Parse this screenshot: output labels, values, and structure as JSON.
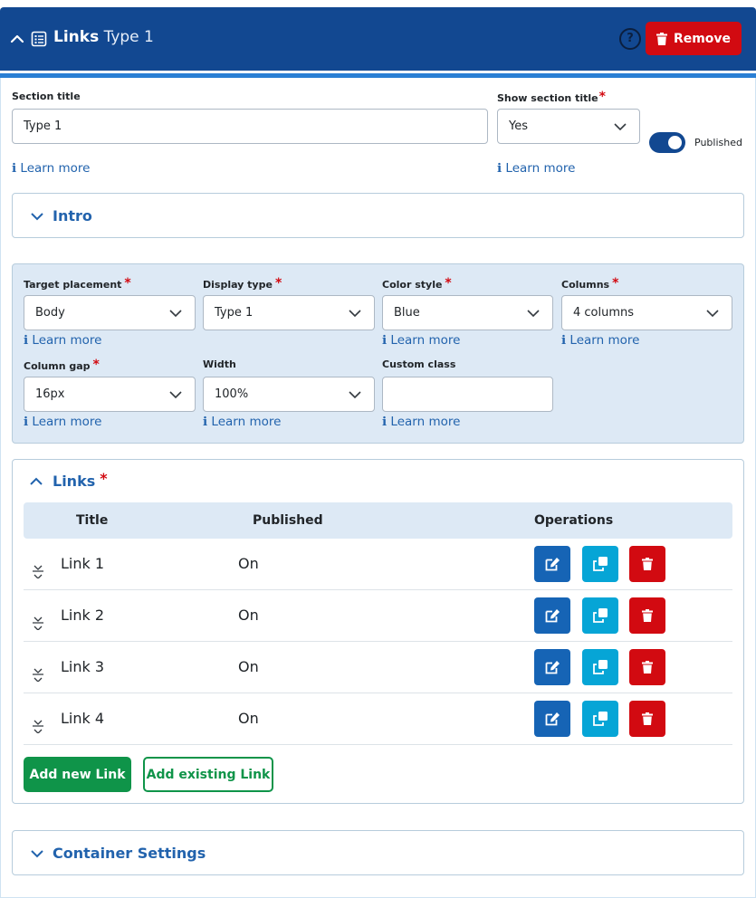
{
  "header": {
    "title_bold": "Links",
    "title_sub": "Type 1",
    "help_label": "?",
    "remove_label": "Remove"
  },
  "section": {
    "title_label": "Section title",
    "title_value": "Type 1",
    "show_title_label": "Show section title",
    "show_title_value": "Yes",
    "published_label": "Published",
    "published": true,
    "learn_more": "ℹ Learn more"
  },
  "intro": {
    "label": "Intro"
  },
  "options": {
    "target_placement": {
      "label": "Target placement",
      "value": "Body"
    },
    "display_type": {
      "label": "Display type",
      "value": "Type 1"
    },
    "color_style": {
      "label": "Color style",
      "value": "Blue"
    },
    "columns": {
      "label": "Columns",
      "value": "4 columns"
    },
    "column_gap": {
      "label": "Column gap",
      "value": "16px"
    },
    "width": {
      "label": "Width",
      "value": "100%"
    },
    "custom_class": {
      "label": "Custom class",
      "value": ""
    }
  },
  "links": {
    "label": "Links",
    "required_mark": "*",
    "columns": {
      "title": "Title",
      "published": "Published",
      "operations": "Operations"
    },
    "rows": [
      {
        "title": "Link 1",
        "published": "On"
      },
      {
        "title": "Link 2",
        "published": "On"
      },
      {
        "title": "Link 3",
        "published": "On"
      },
      {
        "title": "Link 4",
        "published": "On"
      }
    ],
    "add_new": "Add new Link",
    "add_existing": "Add existing Link"
  },
  "container_settings": {
    "label": "Container Settings"
  },
  "colors": {
    "header_bg": "#124891",
    "remove_red": "#d20a11",
    "link_blue": "#2263ad",
    "edit_blue": "#1664b5",
    "copy_cyan": "#06a5d6",
    "green": "#0f9449",
    "panel_bg": "#dde9f5"
  }
}
